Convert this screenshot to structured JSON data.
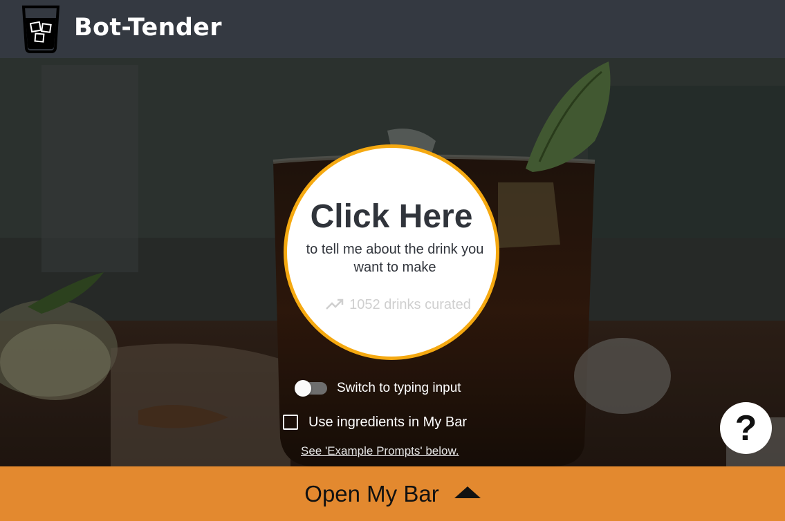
{
  "header": {
    "brand": "Bot-Tender",
    "logo_icon": "whiskey-glass-icon"
  },
  "hero": {
    "background": "cocktail-glass-photo",
    "cta_title": "Click Here",
    "cta_subtitle": "to tell me about the drink you want to make",
    "curated_icon": "trending-up-icon",
    "curated_text": "1052 drinks curated",
    "accent": "#f5a911"
  },
  "controls": {
    "toggle_label": "Switch to typing input",
    "toggle_on": false,
    "checkbox_label": "Use ingredients in My Bar",
    "checkbox_checked": false,
    "example_link": "See 'Example Prompts' below."
  },
  "help": {
    "label": "?"
  },
  "footer": {
    "label": "Open My Bar",
    "icon": "caret-up-icon",
    "color": "#e3892f"
  }
}
